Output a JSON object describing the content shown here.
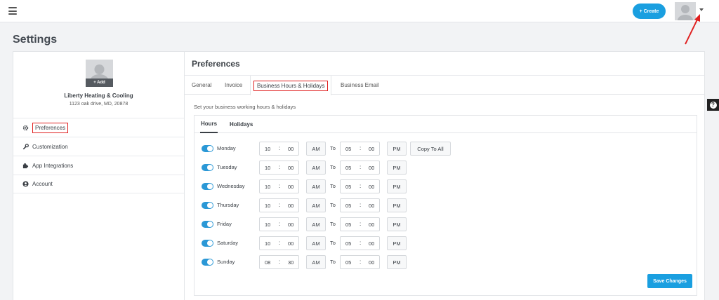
{
  "topbar": {
    "create_label": "+ Create"
  },
  "page": {
    "title": "Settings"
  },
  "company": {
    "add_label": "+ Add",
    "name": "Liberty Heating & Cooling",
    "address": "1123 oak drive, MD, 20878"
  },
  "sidebar": {
    "items": [
      {
        "label": "Preferences",
        "icon": "gear-icon"
      },
      {
        "label": "Customization",
        "icon": "wrench-icon"
      },
      {
        "label": "App Integrations",
        "icon": "puzzle-icon"
      },
      {
        "label": "Account",
        "icon": "user-circle-icon"
      }
    ]
  },
  "preferences": {
    "title": "Preferences",
    "tabs": [
      "General",
      "Invoice",
      "Business Hours & Holidays",
      "Business Email"
    ],
    "active_tab": "Business Hours & Holidays",
    "hint": "Set your business working hours & holidays",
    "subtabs": [
      "Hours",
      "Holidays"
    ],
    "active_subtab": "Hours",
    "to_label": "To",
    "copy_label": "Copy To All",
    "save_label": "Save Changes",
    "days": [
      {
        "name": "Monday",
        "enabled": true,
        "from_h": "10",
        "from_m": "00",
        "from_ampm": "AM",
        "to_h": "05",
        "to_m": "00",
        "to_ampm": "PM"
      },
      {
        "name": "Tuesday",
        "enabled": true,
        "from_h": "10",
        "from_m": "00",
        "from_ampm": "AM",
        "to_h": "05",
        "to_m": "00",
        "to_ampm": "PM"
      },
      {
        "name": "Wednesday",
        "enabled": true,
        "from_h": "10",
        "from_m": "00",
        "from_ampm": "AM",
        "to_h": "05",
        "to_m": "00",
        "to_ampm": "PM"
      },
      {
        "name": "Thursday",
        "enabled": true,
        "from_h": "10",
        "from_m": "00",
        "from_ampm": "AM",
        "to_h": "05",
        "to_m": "00",
        "to_ampm": "PM"
      },
      {
        "name": "Friday",
        "enabled": true,
        "from_h": "10",
        "from_m": "00",
        "from_ampm": "AM",
        "to_h": "05",
        "to_m": "00",
        "to_ampm": "PM"
      },
      {
        "name": "Saturday",
        "enabled": true,
        "from_h": "10",
        "from_m": "00",
        "from_ampm": "AM",
        "to_h": "05",
        "to_m": "00",
        "to_ampm": "PM"
      },
      {
        "name": "Sunday",
        "enabled": true,
        "from_h": "08",
        "from_m": "30",
        "from_ampm": "AM",
        "to_h": "05",
        "to_m": "00",
        "to_ampm": "PM"
      }
    ]
  },
  "colors": {
    "accent": "#1a9fe0",
    "toggle_on": "#2b98d6",
    "highlight": "#e02020"
  }
}
